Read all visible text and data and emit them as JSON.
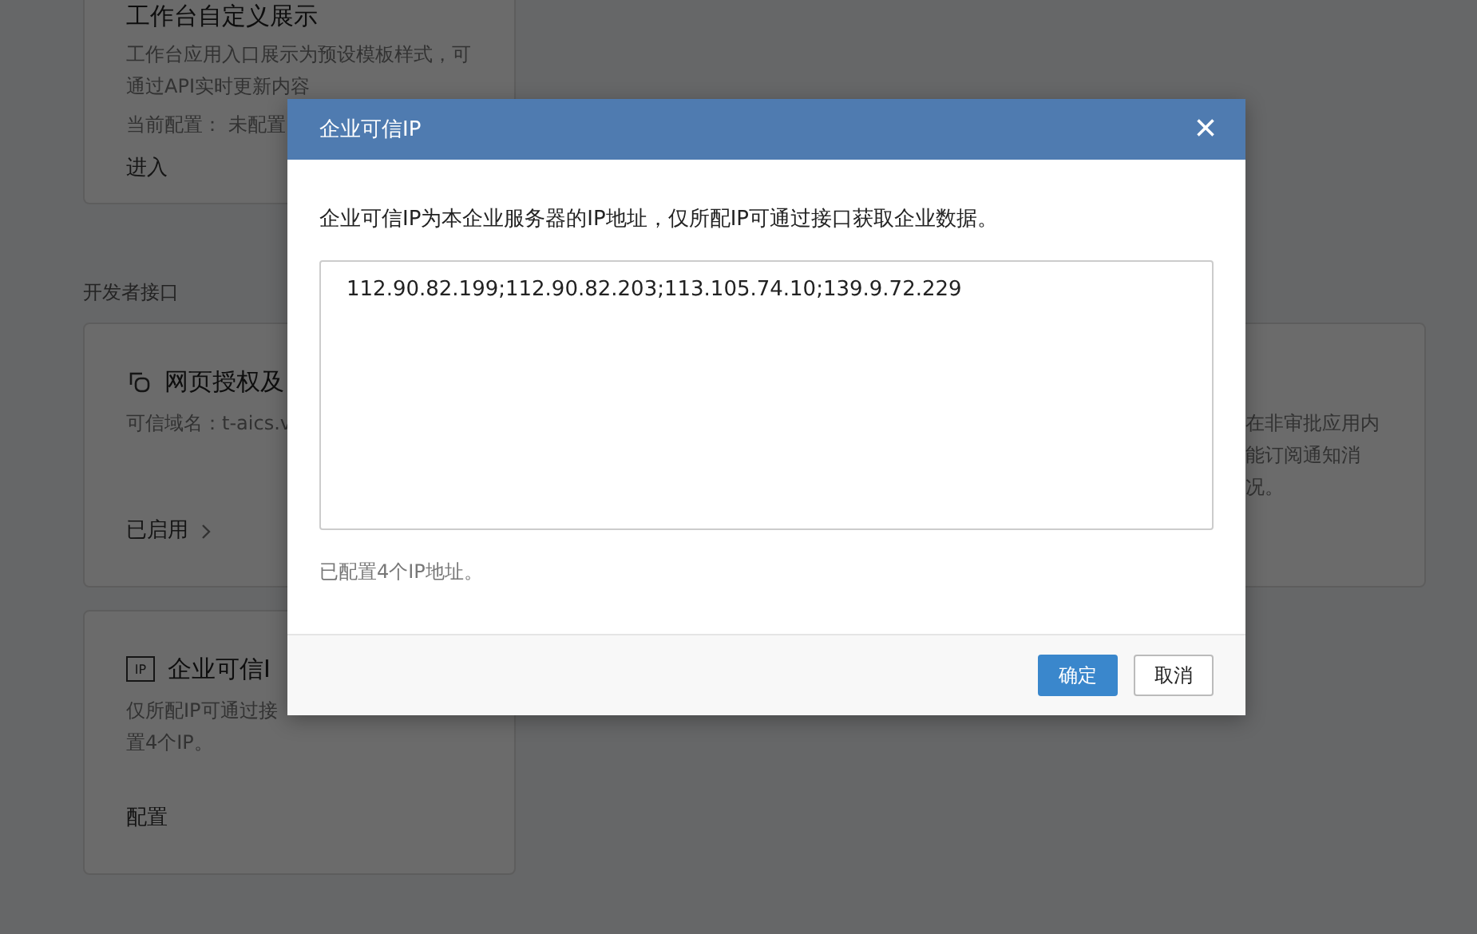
{
  "background": {
    "top_card": {
      "title": "工作台自定义展示",
      "description": "工作台应用入口展示为预设模板样式，可通过API实时更新内容",
      "config": "当前配置： 未配置",
      "link": "进入"
    },
    "section_title": "开发者接口",
    "cards": [
      {
        "kind": "web",
        "title": "网页授权及",
        "description": "可信域名：t-aics.v",
        "link": "已启用"
      },
      {
        "kind": "ip",
        "icon_label": "IP",
        "title": "企业可信I",
        "description": "仅所配IP可通过接",
        "description_2": "置4个IP。",
        "link": "配置"
      }
    ],
    "right_card": {
      "lines": [
        "在非审批应用内",
        "能订阅通知消",
        "况。"
      ]
    }
  },
  "dialog": {
    "title": "企业可信IP",
    "close": "×",
    "intro": "企业可信IP为本企业服务器的IP地址，仅所配IP可通过接口获取企业数据。",
    "ip_list": "112.90.82.199;112.90.82.203;113.105.74.10;139.9.72.229",
    "note": "已配置4个IP地址。",
    "buttons": [
      {
        "kind": "primary",
        "label": "确定"
      },
      {
        "kind": "default",
        "label": "取消"
      }
    ]
  }
}
